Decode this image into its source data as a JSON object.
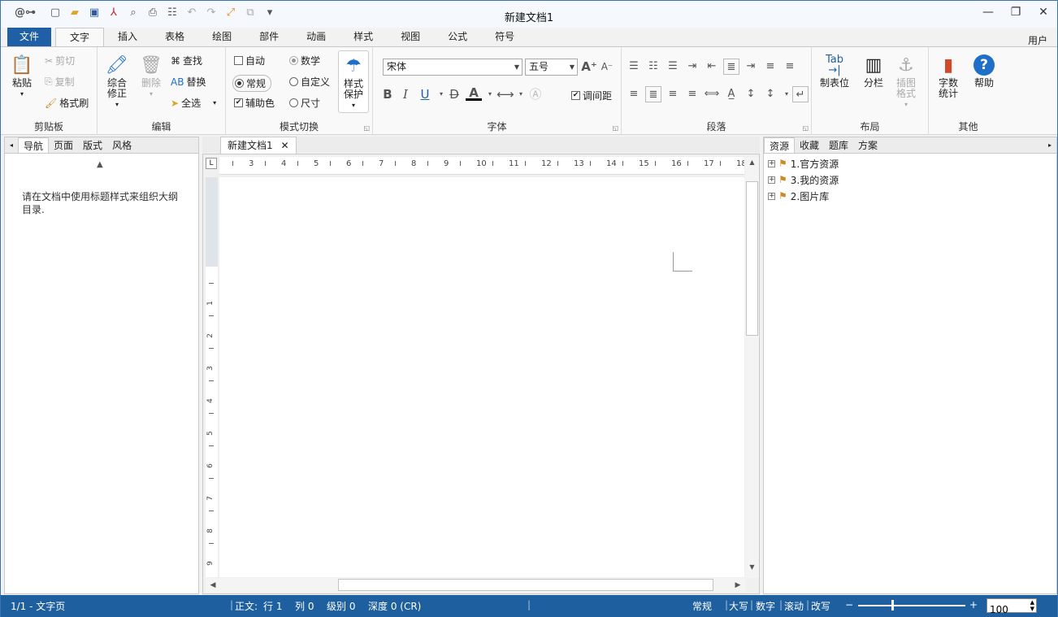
{
  "app": {
    "title": "新建文档1",
    "user": "用户"
  },
  "quick_access": [
    "logo-icon",
    "new-doc-icon",
    "open-icon",
    "save-icon",
    "pdf-icon",
    "preview-icon",
    "print-icon",
    "format-icon",
    "undo-icon",
    "redo-icon",
    "fullscreen-icon",
    "copy-icon",
    "more-icon"
  ],
  "tabs": [
    "文件",
    "文字",
    "插入",
    "表格",
    "绘图",
    "部件",
    "动画",
    "样式",
    "视图",
    "公式",
    "符号"
  ],
  "ribbon": {
    "clipboard": {
      "label": "剪贴板",
      "paste": "粘贴",
      "cut": "剪切",
      "copy": "复制",
      "format_painter": "格式刷"
    },
    "edit": {
      "label": "编辑",
      "revise": "综合\n修正",
      "delete": "删除",
      "find": "查找",
      "replace": "替换",
      "select_all": "全选"
    },
    "mode": {
      "label": "模式切换",
      "auto": "自动",
      "normal": "常规",
      "assist": "辅助色",
      "math": "数学",
      "custom": "自定义",
      "size": "尺寸",
      "style_protect": "样式\n保护"
    },
    "font": {
      "label": "字体",
      "name": "宋体",
      "size": "五号",
      "spacing": "调间距"
    },
    "paragraph": {
      "label": "段落"
    },
    "layout": {
      "label": "布局",
      "tab_pos": "制表位",
      "columns": "分栏",
      "img_format": "插图\n格式",
      "tab_text": "Tab"
    },
    "other": {
      "label": "其他",
      "word_count": "字数\n统计",
      "help": "帮助"
    }
  },
  "left_panel": {
    "tabs": [
      "导航",
      "页面",
      "版式",
      "风格"
    ],
    "message": "请在文档中使用标题样式来组织大纲目录."
  },
  "document": {
    "tab": "新建文档1",
    "close": "✕",
    "ruler_h": [
      "3",
      "4",
      "5",
      "6",
      "7",
      "8",
      "9",
      "10",
      "11",
      "12",
      "13",
      "14",
      "15",
      "16",
      "17",
      "18"
    ],
    "ruler_v": [
      "1",
      "2",
      "3",
      "4",
      "5",
      "6",
      "7",
      "8",
      "9"
    ]
  },
  "right_panel": {
    "tabs": [
      "资源",
      "收藏",
      "题库",
      "方案"
    ],
    "tree": [
      "1.官方资源",
      "3.我的资源",
      "2.图片库"
    ]
  },
  "status": {
    "page": "1/1 - 文字页",
    "body": "正文:",
    "row": "行 1",
    "col": "列 0",
    "level": "级别 0",
    "depth": "深度 0 (CR)",
    "mode": "常规",
    "caps": "大写",
    "num": "数字",
    "scroll": "滚动",
    "overwrite": "改写",
    "zoom": "100"
  }
}
